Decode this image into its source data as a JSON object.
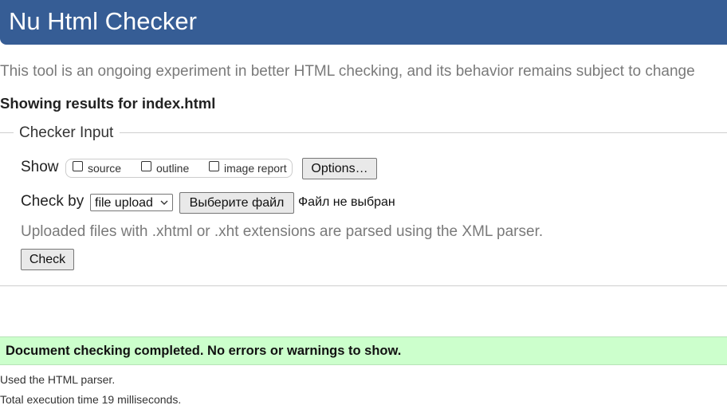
{
  "header": {
    "title": "Nu Html Checker"
  },
  "intro": "This tool is an ongoing experiment in better HTML checking, and its behavior remains subject to change",
  "results_heading": "Showing results for index.html",
  "checker_input": {
    "legend": "Checker Input",
    "show_label": "Show",
    "show_options": [
      {
        "label": "source",
        "checked": false
      },
      {
        "label": "outline",
        "checked": false
      },
      {
        "label": "image report",
        "checked": false
      }
    ],
    "options_button": "Options…",
    "check_by_label": "Check by",
    "check_by_value": "file upload",
    "choose_file_button": "Выберите файл",
    "file_status": "Файл не выбран",
    "hint": "Uploaded files with .xhtml or .xht extensions are parsed using the XML parser.",
    "check_button": "Check"
  },
  "result": {
    "message": "Document checking completed. No errors or warnings to show.",
    "parser_note": "Used the HTML parser.",
    "execution_time": "Total execution time 19 milliseconds."
  },
  "colors": {
    "header_bg": "#365d95",
    "success_bg": "#ccffcc",
    "muted_text": "#7a7a7a"
  }
}
